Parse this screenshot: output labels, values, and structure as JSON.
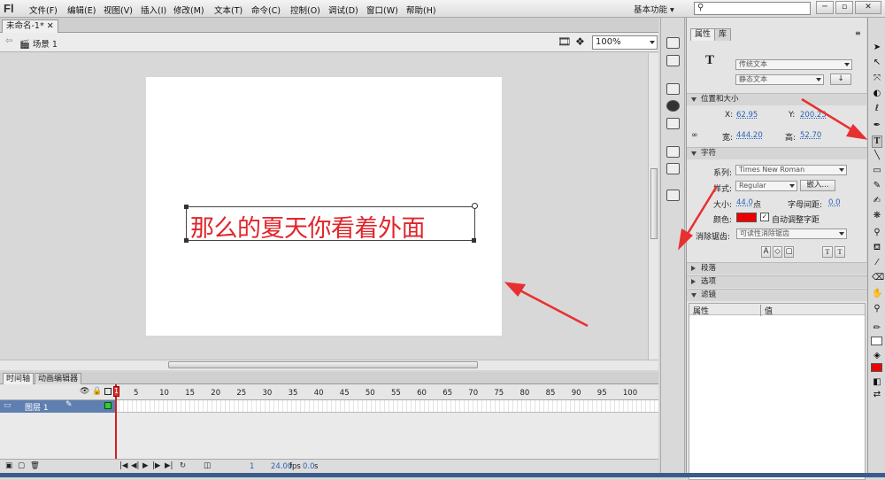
{
  "app": {
    "logo": "Fl"
  },
  "menubar": {
    "items": [
      "文件(F)",
      "编辑(E)",
      "视图(V)",
      "插入(I)",
      "修改(M)",
      "文本(T)",
      "命令(C)",
      "控制(O)",
      "调试(D)",
      "窗口(W)",
      "帮助(H)"
    ],
    "workspace": "基本功能",
    "search_placeholder": "",
    "window_buttons": [
      "─",
      "▫",
      "✕"
    ]
  },
  "document": {
    "tab_title": "未命名-1*",
    "scene": "场景 1",
    "zoom": "100%"
  },
  "stage": {
    "text": "那么的夏天你看着外面",
    "text_color": "#e0252b",
    "background": "#ffffff"
  },
  "timeline": {
    "tabs": [
      "时间轴",
      "动画编辑器"
    ],
    "layer": "图层 1",
    "frame_numbers": [
      "5",
      "10",
      "15",
      "20",
      "25",
      "30",
      "35",
      "40",
      "45",
      "50",
      "55",
      "60",
      "65",
      "70",
      "75",
      "80",
      "85",
      "90",
      "95",
      "100"
    ],
    "current_frame": "1",
    "fps": "24.00",
    "fps_unit": "fps",
    "time": "0.0",
    "time_unit": "s"
  },
  "properties": {
    "tabs": [
      "属性",
      "库"
    ],
    "tool_glyph": "T",
    "text_engine": "传统文本",
    "text_type": "静态文本",
    "section_position": "位置和大小",
    "x_label": "X:",
    "x_value": "62.95",
    "y_label": "Y:",
    "y_value": "200.25",
    "w_label": "宽:",
    "w_value": "444.20",
    "h_label": "高:",
    "h_value": "52.70",
    "section_char": "字符",
    "family_label": "系列:",
    "family": "Times New Roman",
    "style_label": "样式:",
    "style": "Regular",
    "embed_button": "嵌入...",
    "size_label": "大小:",
    "size_value": "44.0",
    "size_unit": "点",
    "spacing_label": "字母间距:",
    "spacing_value": "0.0",
    "color_label": "颜色:",
    "color": "#ee0000",
    "auto_kern": "自动调整字距",
    "aa_label": "消除锯齿:",
    "aa_value": "可读性消除锯齿",
    "section_paragraph": "段落",
    "section_options": "选项",
    "section_filters": "滤镜",
    "filter_col_property": "属性",
    "filter_col_value": "值"
  },
  "colors": {
    "accent_red": "#e83030",
    "layer_highlight": "#5f7fb0"
  }
}
